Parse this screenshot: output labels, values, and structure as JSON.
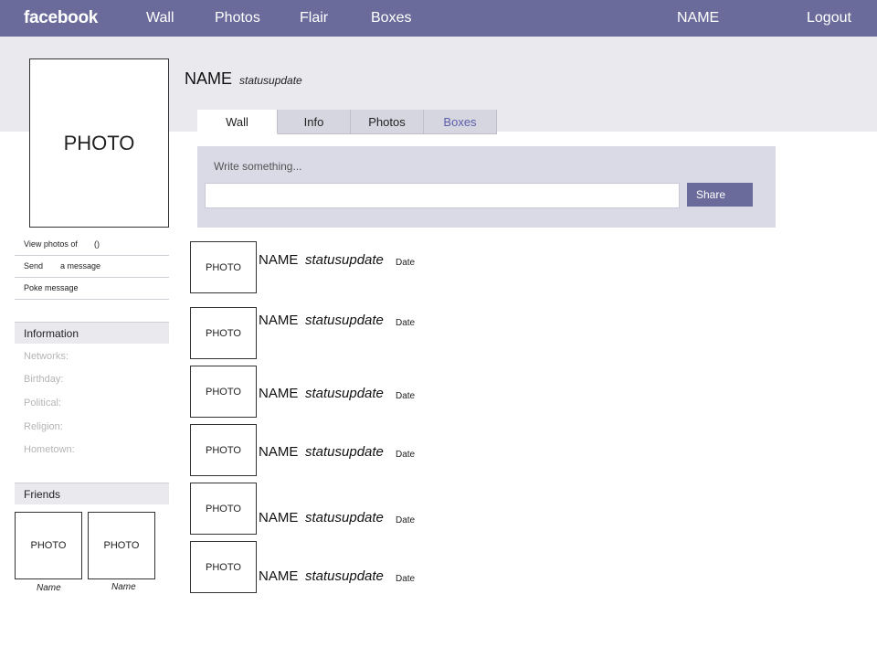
{
  "topnav": {
    "logo": "facebook",
    "links": [
      "Wall",
      "Photos",
      "Flair",
      "Boxes"
    ],
    "user_name": "NAME",
    "logout": "Logout"
  },
  "profile": {
    "photo_label": "PHOTO",
    "name": "NAME",
    "status": "statusupdate"
  },
  "tabs": [
    "Wall",
    "Info",
    "Photos",
    "Boxes"
  ],
  "composer": {
    "prompt": "Write something...",
    "input_value": "",
    "share_label": "Share"
  },
  "sidebar_links": [
    {
      "label": "View photos of",
      "extra": "()"
    },
    {
      "label": "Send",
      "extra": "a message"
    },
    {
      "label": "Poke message",
      "extra": ""
    }
  ],
  "information": {
    "title": "Information",
    "fields": [
      "Networks:",
      "Birthday:",
      "Political:",
      "Religion:",
      "Hometown:"
    ]
  },
  "friends": {
    "title": "Friends",
    "items": [
      {
        "photo": "PHOTO",
        "name": "Name"
      },
      {
        "photo": "PHOTO",
        "name": "Name"
      }
    ]
  },
  "posts": [
    {
      "photo": "PHOTO",
      "name": "NAME",
      "status": "statusupdate",
      "date": "Date"
    },
    {
      "photo": "PHOTO",
      "name": "NAME",
      "status": "statusupdate",
      "date": "Date"
    },
    {
      "photo": "PHOTO",
      "name": "NAME",
      "status": "statusupdate",
      "date": "Date"
    },
    {
      "photo": "PHOTO",
      "name": "NAME",
      "status": "statusupdate",
      "date": "Date"
    },
    {
      "photo": "PHOTO",
      "name": "NAME",
      "status": "statusupdate",
      "date": "Date"
    },
    {
      "photo": "PHOTO",
      "name": "NAME",
      "status": "statusupdate",
      "date": "Date"
    }
  ],
  "colors": {
    "topbar": "#6b6b9b",
    "band": "#e9e9ee",
    "composer": "#d9dae6",
    "accent_tab": "#5c5caa"
  }
}
